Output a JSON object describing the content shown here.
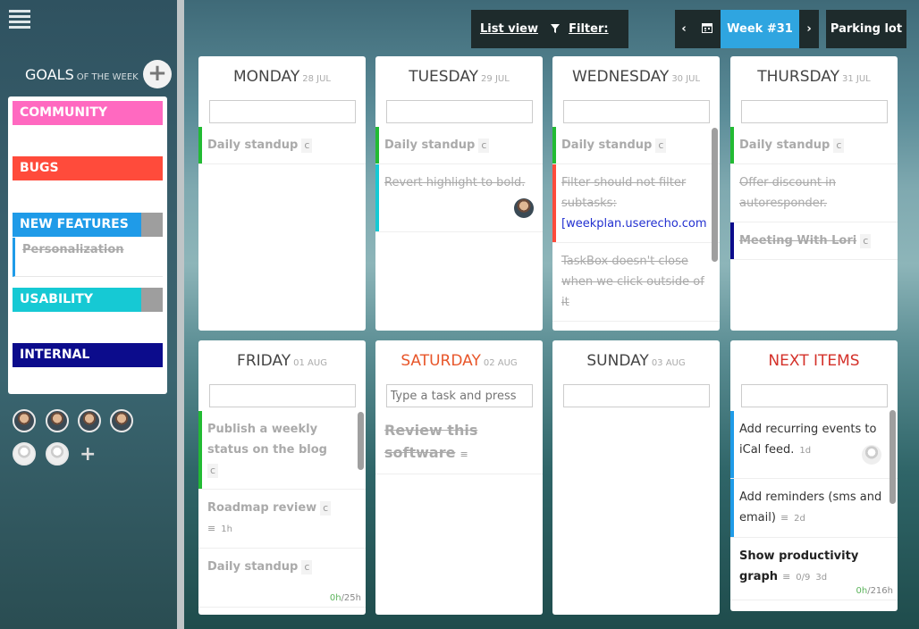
{
  "sidebar": {
    "goals_title": "GOALS",
    "goals_subtitle": "OF THE WEEK",
    "add_label": "+",
    "goals": [
      {
        "label": "COMMUNITY",
        "color": "#ff69c0"
      },
      {
        "label": "BUGS",
        "color": "#ff4b3b"
      },
      {
        "label": "NEW FEATURES",
        "color": "#1f9be8"
      },
      {
        "label": "USABILITY",
        "color": "#16c9d4"
      },
      {
        "label": "INTERNAL",
        "color": "#0c0c8c"
      }
    ],
    "subgoal": "Personalization",
    "add_member": "+"
  },
  "toolbar": {
    "list_view": "List view",
    "filter": "Filter: off",
    "filter_icon": "funnel-icon",
    "prev": "‹",
    "calendar_icon": "calendar-icon",
    "week": "Week #31",
    "next": "›",
    "parking_lot": "Parking lot"
  },
  "days": [
    {
      "name": "MONDAY",
      "date": "28 JUL",
      "tasks": [
        {
          "text": "Daily standup",
          "color": "#22bb33"
        }
      ]
    },
    {
      "name": "TUESDAY",
      "date": "29 JUL",
      "tasks": [
        {
          "text": "Daily standup",
          "color": "#22bb33"
        },
        {
          "text": "Revert highlight to bold.",
          "color": "#16c9d4"
        }
      ]
    },
    {
      "name": "WEDNESDAY",
      "date": "30 JUL",
      "tasks": [
        {
          "text": "Daily standup",
          "color": "#22bb33"
        },
        {
          "text": "Filter should not filter subtasks:",
          "link": "[weekplan.userecho.com",
          "color": "#ff4b3b"
        },
        {
          "text": "TaskBox doesn't close when we click outside of it"
        }
      ]
    },
    {
      "name": "THURSDAY",
      "date": "31 JUL",
      "tasks": [
        {
          "text": "Daily standup",
          "color": "#22bb33"
        },
        {
          "text": "Offer discount in autoresponder."
        },
        {
          "text": "Meeting With Lori",
          "color": "#0c0c8c"
        }
      ]
    },
    {
      "name": "FRIDAY",
      "date": "01 AUG",
      "tasks": [
        {
          "text": "Publish a weekly status on the blog",
          "color": "#22bb33"
        },
        {
          "text": "Roadmap review",
          "estimate": "1h"
        },
        {
          "text": "Daily standup"
        }
      ],
      "time_spent": "0h",
      "time_total": "/25h"
    },
    {
      "name": "SATURDAY",
      "date": "02 AUG",
      "placeholder": "Type a task and press",
      "tasks": [
        {
          "text": "Review this software"
        }
      ]
    },
    {
      "name": "SUNDAY",
      "date": "03 AUG",
      "tasks": []
    },
    {
      "name": "NEXT ITEMS",
      "date": "",
      "tasks": [
        {
          "text": "Add recurring events to iCal feed.",
          "age": "1d",
          "color": "#1f9be8"
        },
        {
          "text": "Add reminders (sms and email)",
          "age": "2d",
          "color": "#1f9be8"
        },
        {
          "text": "Show productivity graph",
          "progress": "0/9",
          "age": "3d"
        }
      ],
      "time_spent": "0h",
      "time_total": "/216h"
    }
  ],
  "repeat_glyph": "c",
  "notes_glyph": "≡"
}
